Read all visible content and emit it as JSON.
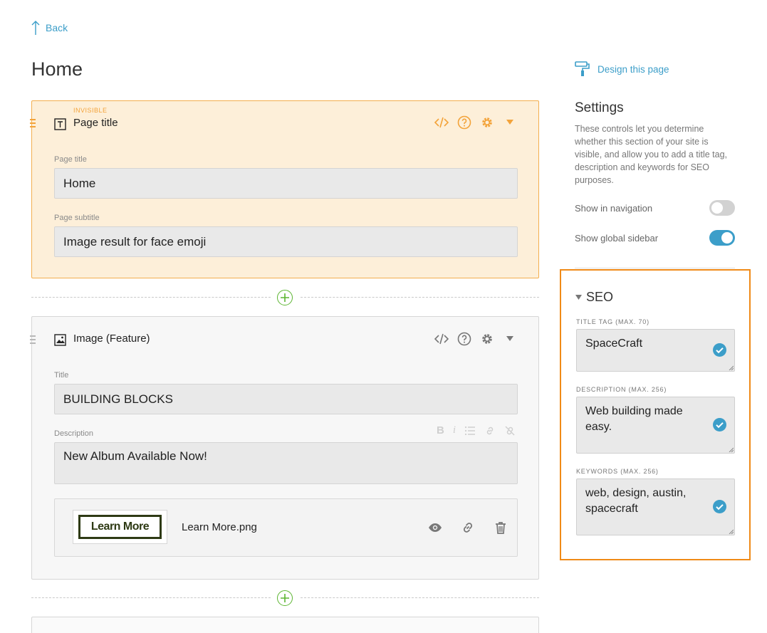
{
  "nav": {
    "back_label": "Back"
  },
  "page": {
    "title": "Home"
  },
  "blocks": [
    {
      "status": "INVISIBLE",
      "name": "Page title",
      "fields": [
        {
          "label": "Page title",
          "value": "Home"
        },
        {
          "label": "Page subtitle",
          "value": "Image result for face emoji"
        }
      ]
    },
    {
      "name": "Image (Feature)",
      "fields": [
        {
          "label": "Title",
          "value": "BUILDING BLOCKS"
        },
        {
          "label": "Description",
          "value": "New Album Available Now!"
        }
      ],
      "file": {
        "thumb_text": "Learn More",
        "name": "Learn More.png"
      }
    }
  ],
  "sidebar": {
    "design_link": "Design this page",
    "settings_title": "Settings",
    "settings_desc": "These controls let you determine whether this section of your site is visible, and allow you to add a title tag, description and keywords for SEO purposes.",
    "toggles": [
      {
        "label": "Show in navigation",
        "state": "off"
      },
      {
        "label": "Show global sidebar",
        "state": "on"
      }
    ],
    "seo": {
      "title": "SEO",
      "fields": [
        {
          "label": "TITLE TAG (MAX. 70)",
          "value": "SpaceCraft"
        },
        {
          "label": "DESCRIPTION (MAX. 256)",
          "value": "Web building made easy."
        },
        {
          "label": "KEYWORDS (MAX. 256)",
          "value": "web, design, austin, spacecraft"
        }
      ]
    }
  },
  "colors": {
    "accent": "#3c9ec9",
    "warning": "#f3a33a",
    "highlight": "#f08a17",
    "add": "#5cb531"
  }
}
